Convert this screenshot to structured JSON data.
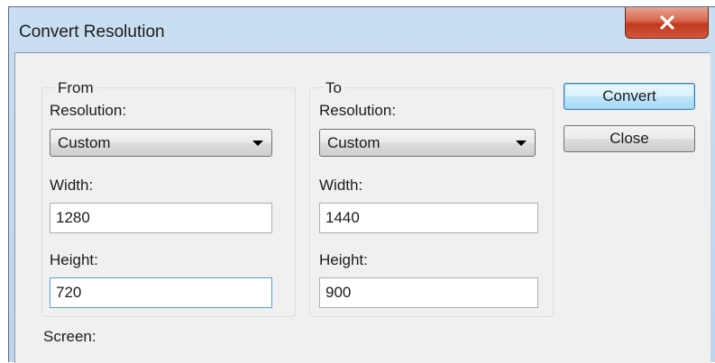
{
  "window": {
    "title": "Convert Resolution",
    "close_icon": "close-icon"
  },
  "from": {
    "legend": "From",
    "resolution_label": "Resolution:",
    "resolution_value": "Custom",
    "width_label": "Width:",
    "width_value": "1280",
    "height_label": "Height:",
    "height_value": "720"
  },
  "to": {
    "legend": "To",
    "resolution_label": "Resolution:",
    "resolution_value": "Custom",
    "width_label": "Width:",
    "width_value": "1440",
    "height_label": "Height:",
    "height_value": "900"
  },
  "buttons": {
    "convert": "Convert",
    "close": "Close"
  },
  "screen_label": "Screen:",
  "colors": {
    "titlebar": "#c9dff1",
    "close_button": "#c8442a",
    "dialog_bg": "#f0f0f0",
    "focus_border": "#569de5"
  }
}
